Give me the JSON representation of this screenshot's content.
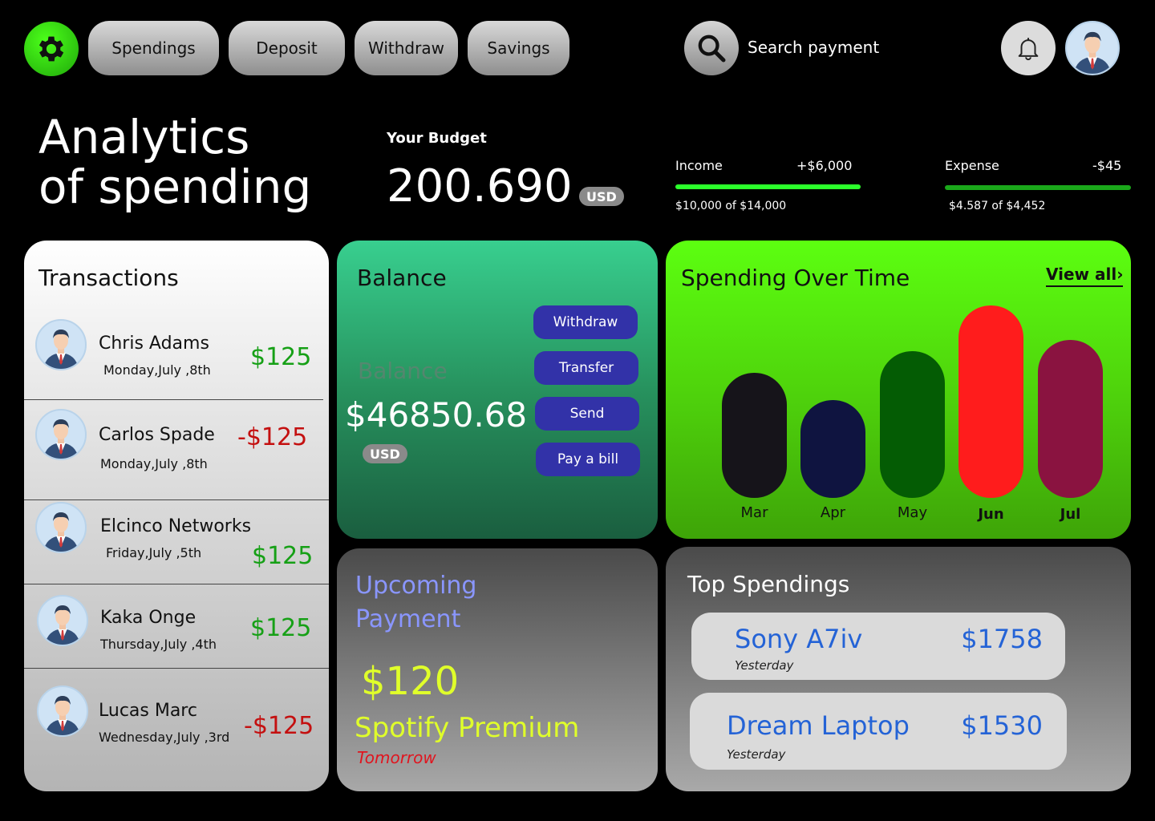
{
  "topbar": {
    "tabs": [
      "Spendings",
      "Deposit",
      "Withdraw",
      "Savings"
    ],
    "search_label": "Search payment"
  },
  "header": {
    "title_line1": "Analytics",
    "title_line2": "of spending",
    "budget_label": "Your Budget",
    "budget_value": "200.690",
    "budget_currency": "USD",
    "income": {
      "label": "Income",
      "amount": "+$6,000",
      "sub": "$10,000 of $14,000",
      "color": "#2bff2b",
      "progress": 1.0
    },
    "expense": {
      "label": "Expense",
      "amount": "-$45",
      "sub": "$4.587 of $4,452",
      "color": "#1aa81a",
      "progress": 1.0
    }
  },
  "transactions": {
    "title": "Transactions",
    "items": [
      {
        "name": "Chris Adams",
        "date": "Monday,July ,8th",
        "amount": "$125",
        "color": "#16a016"
      },
      {
        "name": "Carlos Spade",
        "date": "Monday,July ,8th",
        "amount": "-$125",
        "color": "#c41010"
      },
      {
        "name": "Elcinco Networks",
        "date": "Friday,July ,5th",
        "amount": "$125",
        "color": "#16a016"
      },
      {
        "name": "Kaka Onge",
        "date": "Thursday,July ,4th",
        "amount": "$125",
        "color": "#16a016"
      },
      {
        "name": "Lucas Marc",
        "date": "Wednesday,July ,3rd",
        "amount": "-$125",
        "color": "#c41010"
      }
    ]
  },
  "balance": {
    "title": "Balance",
    "ghost_label": "Balance",
    "value": "$46850.68",
    "currency": "USD",
    "actions": [
      "Withdraw",
      "Transfer",
      "Send",
      "Pay a bill"
    ]
  },
  "spending_over_time": {
    "title": "Spending Over Time",
    "view_all": "View all"
  },
  "chart_data": {
    "type": "bar",
    "title": "Spending Over Time",
    "categories": [
      "Mar",
      "Apr",
      "May",
      "Jun",
      "Jul"
    ],
    "values": [
      156,
      122,
      183,
      240,
      197
    ],
    "colors": [
      "#16141a",
      "#0f1440",
      "#045c04",
      "#ff1c1c",
      "#8a1340"
    ],
    "ylim": [
      0,
      240
    ],
    "grid": false
  },
  "upcoming": {
    "title_line1": "Upcoming",
    "title_line2": "Payment",
    "amount": "$120",
    "name": "Spotify Premium",
    "when": "Tomorrow"
  },
  "top_spendings": {
    "title": "Top Spendings",
    "items": [
      {
        "name": "Sony A7iv",
        "amount": "$1758",
        "when": "Yesterday"
      },
      {
        "name": "Dream Laptop",
        "amount": "$1530",
        "when": "Yesterday"
      }
    ]
  },
  "icons": {
    "gear": "gear-icon",
    "search": "search-icon",
    "bell": "bell-icon",
    "avatar": "user-avatar-icon"
  }
}
